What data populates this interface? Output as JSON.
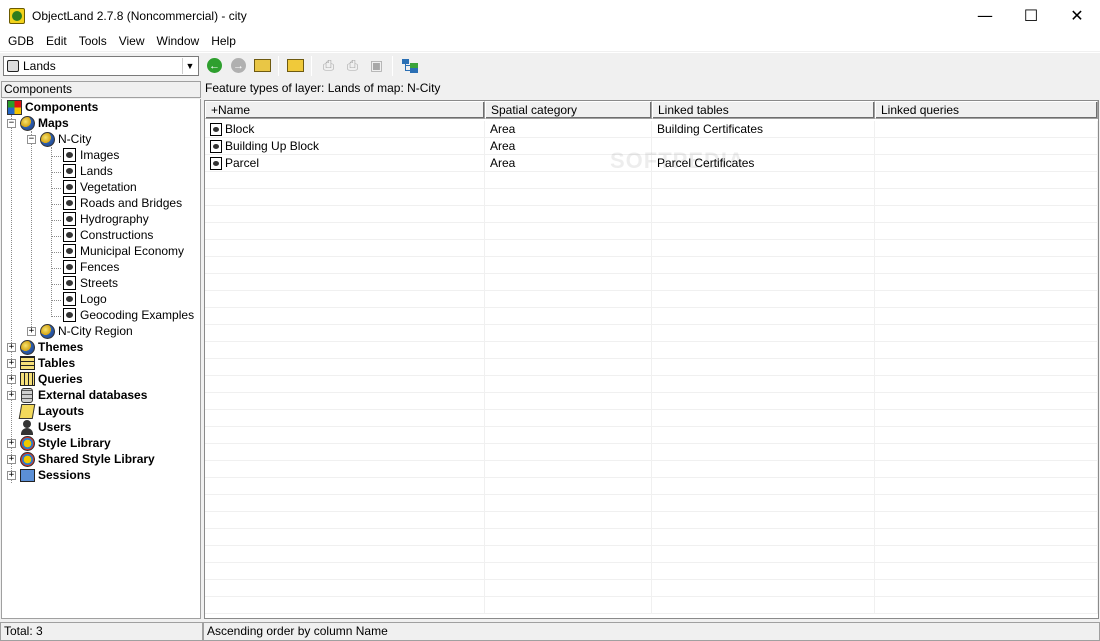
{
  "window": {
    "title": "ObjectLand 2.7.8 (Noncommercial) - city",
    "minimize": "—",
    "maximize": "☐",
    "close": "✕"
  },
  "menu": [
    "GDB",
    "Edit",
    "Tools",
    "View",
    "Window",
    "Help"
  ],
  "toolbar": {
    "layer_select_value": "Lands"
  },
  "left_panel": {
    "header": "Components",
    "tree": [
      {
        "label": "Components",
        "bold": true,
        "icon": "components-icon"
      },
      {
        "label": "Maps",
        "bold": true,
        "icon": "globe-icon"
      },
      {
        "label": "N-City",
        "bold": false,
        "icon": "globe-icon"
      },
      {
        "label": "Images",
        "icon": "layer-icon"
      },
      {
        "label": "Lands",
        "icon": "layer-icon"
      },
      {
        "label": "Vegetation",
        "icon": "layer-icon"
      },
      {
        "label": "Roads and Bridges",
        "icon": "layer-icon"
      },
      {
        "label": "Hydrography",
        "icon": "layer-icon"
      },
      {
        "label": "Constructions",
        "icon": "layer-icon"
      },
      {
        "label": "Municipal Economy",
        "icon": "layer-icon"
      },
      {
        "label": "Fences",
        "icon": "layer-icon"
      },
      {
        "label": "Streets",
        "icon": "layer-icon"
      },
      {
        "label": "Logo",
        "icon": "layer-icon"
      },
      {
        "label": "Geocoding Examples",
        "icon": "layer-icon"
      },
      {
        "label": "N-City Region",
        "icon": "globe-icon"
      },
      {
        "label": "Themes",
        "bold": true,
        "icon": "globe-icon"
      },
      {
        "label": "Tables",
        "bold": true,
        "icon": "table-icon"
      },
      {
        "label": "Queries",
        "bold": true,
        "icon": "table-icon"
      },
      {
        "label": "External databases",
        "bold": true,
        "icon": "database-icon"
      },
      {
        "label": "Layouts",
        "bold": true,
        "icon": "layout-icon"
      },
      {
        "label": "Users",
        "bold": true,
        "icon": "user-icon"
      },
      {
        "label": "Style Library",
        "bold": true,
        "icon": "style-icon"
      },
      {
        "label": "Shared Style Library",
        "bold": true,
        "icon": "style-icon"
      },
      {
        "label": "Sessions",
        "bold": true,
        "icon": "sessions-icon"
      }
    ]
  },
  "right_panel": {
    "header": "Feature types of layer: Lands of map: N-City",
    "columns": [
      "+Name",
      "Spatial category",
      "Linked tables",
      "Linked queries"
    ],
    "rows": [
      [
        "Block",
        "Area",
        "Building Certificates",
        ""
      ],
      [
        "Building Up Block",
        "Area",
        "",
        ""
      ],
      [
        "Parcel",
        "Area",
        "Parcel Certificates",
        ""
      ]
    ],
    "watermark": "SOFTPEDIA"
  },
  "status": {
    "left": "Total: 3",
    "right": "Ascending order by column Name"
  }
}
